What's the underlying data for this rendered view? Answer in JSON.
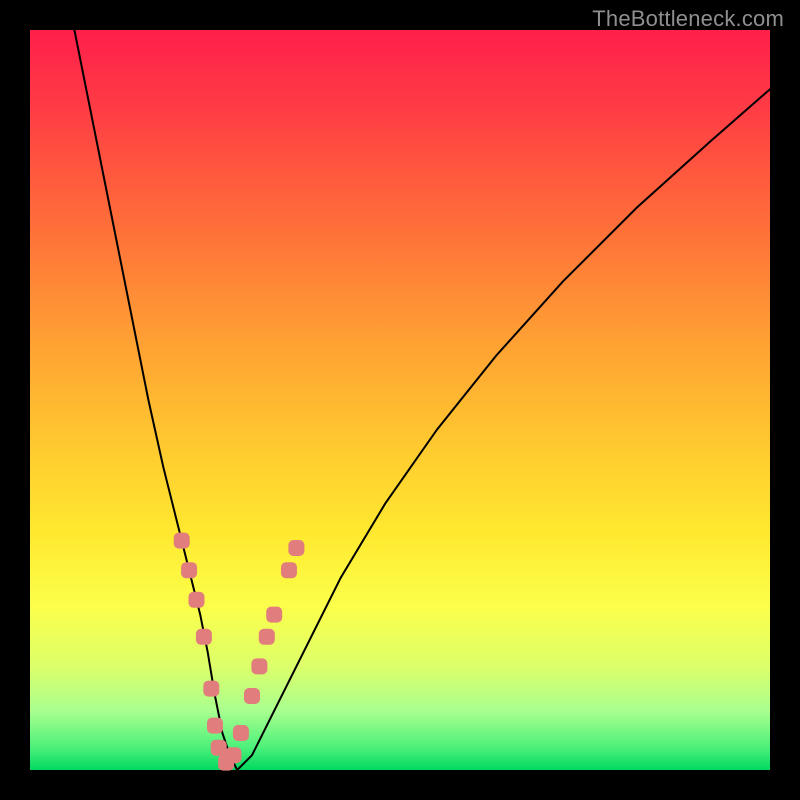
{
  "watermark": "TheBottleneck.com",
  "colors": {
    "background": "#000000",
    "gradient_top": "#ff1f4b",
    "gradient_bottom": "#00d860",
    "curve": "#000000",
    "marker": "#e17d7d"
  },
  "chart_data": {
    "type": "line",
    "title": "",
    "xlabel": "",
    "ylabel": "",
    "xlim": [
      0,
      100
    ],
    "ylim": [
      0,
      100
    ],
    "series": [
      {
        "name": "bottleneck-curve",
        "x": [
          6,
          8,
          10,
          12,
          14,
          16,
          18,
          20,
          21,
          22,
          23,
          24,
          25,
          26,
          27,
          28,
          30,
          32,
          35,
          38,
          42,
          48,
          55,
          63,
          72,
          82,
          92,
          100
        ],
        "y": [
          100,
          90,
          80,
          70,
          60,
          50,
          41,
          33,
          29,
          25,
          21,
          16,
          10,
          5,
          2,
          0,
          2,
          6,
          12,
          18,
          26,
          36,
          46,
          56,
          66,
          76,
          85,
          92
        ]
      }
    ],
    "markers": {
      "name": "highlight-points",
      "x": [
        20.5,
        21.5,
        22.5,
        23.5,
        24.5,
        25.0,
        25.5,
        26.5,
        27.5,
        28.5,
        30.0,
        31.0,
        32.0,
        33.0,
        35.0,
        36.0
      ],
      "y": [
        31,
        27,
        23,
        18,
        11,
        6,
        3,
        1,
        2,
        5,
        10,
        14,
        18,
        21,
        27,
        30
      ]
    }
  }
}
